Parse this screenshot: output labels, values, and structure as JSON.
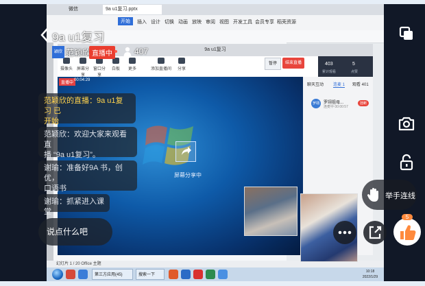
{
  "desktop": {
    "browser_tab": "微信",
    "file_tab": "9a u1复习.pptx",
    "ribbon": [
      "开始",
      "插入",
      "设计",
      "切换",
      "动画",
      "放映",
      "审阅",
      "视图",
      "开发工具",
      "会员专享",
      "稻壳资源"
    ],
    "ribbon_active": "开始",
    "stream_window_title": "9a u1复习",
    "tools": [
      "摄像头",
      "屏幕分享",
      "窗口分享",
      "白板",
      "更多",
      "添加直播间",
      "分享"
    ],
    "pause_label": "暂停",
    "end_label": "结束直播",
    "stats": [
      {
        "value": "403",
        "label": "累计观看"
      },
      {
        "value": "5",
        "label": "点赞"
      }
    ],
    "side_tabs": [
      "聊天互动",
      "连麦 1",
      "观看 401"
    ],
    "side_tab_active": "连麦 1",
    "viewer": {
      "avatar": "罗翊",
      "name": "罗翊祖母...",
      "time": "连麦中 00:00:57",
      "button": "挂断"
    },
    "preview_badge": "直播中",
    "preview_time": "00:04:29",
    "share_label": "屏幕分享中",
    "status_text": "幻灯片 1 / 20   Office 主题",
    "taskbar_items": [
      "第三方应用(45)",
      "搜索一下"
    ],
    "clock": {
      "time": "10:18",
      "date": "2022/1/29"
    }
  },
  "overlay": {
    "back_icon": "chevron-left-icon",
    "room_title": "9a u1复习",
    "host_avatar": "颖欣",
    "host_name": "范颖欣",
    "live_label": "直播中",
    "viewer_count": "407",
    "chats": [
      {
        "line1": "范颖欣的直播：9a u1复习 已",
        "line2": "开始"
      },
      {
        "line1": "范颖欣：欢迎大家来观看直",
        "line2": "播 “9a u1复习”。"
      },
      {
        "line1": "谢瑜：准备好9A 书，创优，",
        "line2": "口语书"
      },
      {
        "line1": "谢瑜：抓紧进入课堂",
        "line2": ""
      }
    ],
    "input_placeholder": "说点什么吧",
    "raise_hand_label": "举手连线",
    "like_count": "5",
    "right_icons": [
      "screen-switch-icon",
      "camera-flip-icon",
      "unlock-icon",
      "raise-hand-icon",
      "share-icon",
      "more-icon",
      "like-icon"
    ],
    "colors": {
      "live": "#ea3d2f",
      "host_msg": "#ffd34d",
      "like": "#ff8a3d"
    }
  }
}
